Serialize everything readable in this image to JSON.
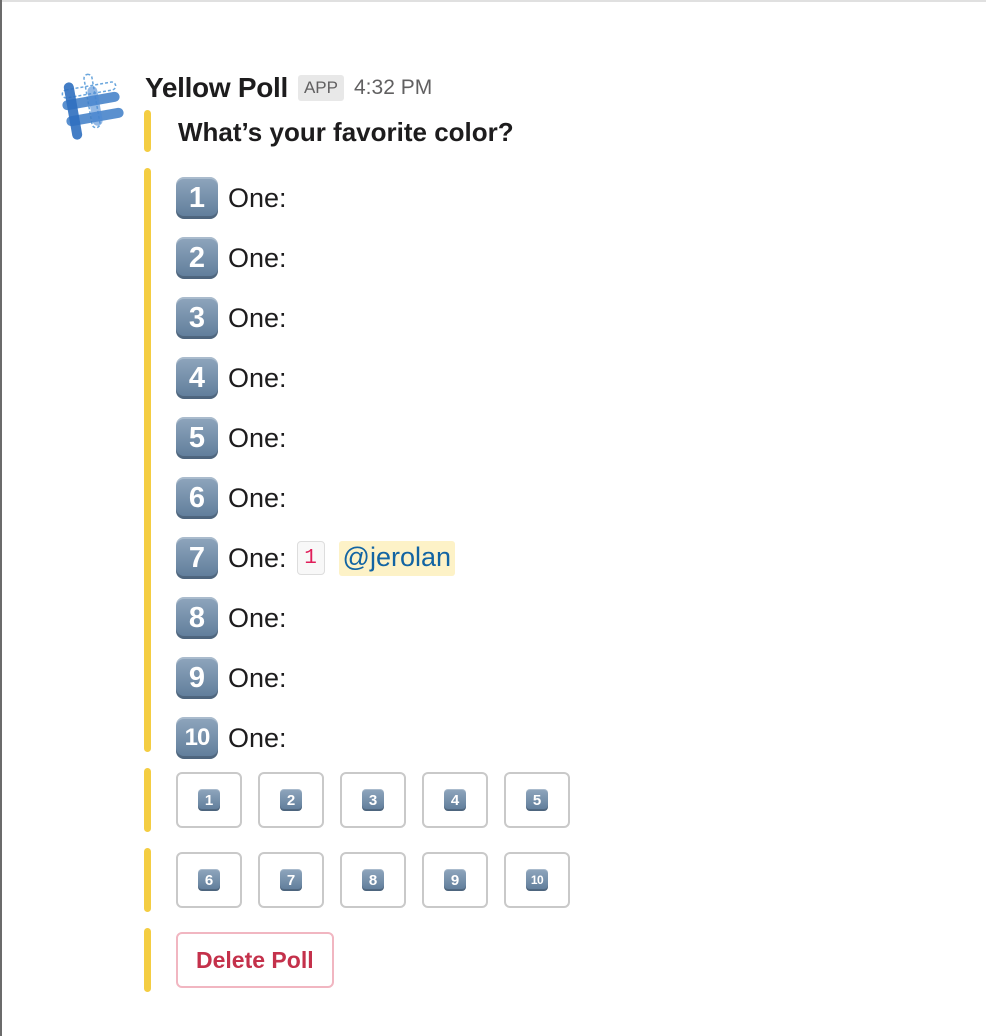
{
  "message": {
    "bot_name": "Yellow Poll",
    "badge": "APP",
    "timestamp": "4:32 PM",
    "avatar_icon": "yellow-poll-hashtag-icon",
    "accent_color": "#f4cd42"
  },
  "poll": {
    "question": "What’s your favorite color?",
    "options": [
      {
        "number": "1",
        "label": "One:"
      },
      {
        "number": "2",
        "label": "One:"
      },
      {
        "number": "3",
        "label": "One:"
      },
      {
        "number": "4",
        "label": "One:"
      },
      {
        "number": "5",
        "label": "One:"
      },
      {
        "number": "6",
        "label": "One:"
      },
      {
        "number": "7",
        "label": "One:",
        "vote_count": "1",
        "voter": "@jerolan"
      },
      {
        "number": "8",
        "label": "One:"
      },
      {
        "number": "9",
        "label": "One:"
      },
      {
        "number": "10",
        "label": "One:"
      }
    ]
  },
  "vote_buttons": {
    "row1": [
      "1",
      "2",
      "3",
      "4",
      "5"
    ],
    "row2": [
      "6",
      "7",
      "8",
      "9",
      "10"
    ]
  },
  "delete_button": {
    "label": "Delete Poll",
    "color": "#c4314b"
  }
}
